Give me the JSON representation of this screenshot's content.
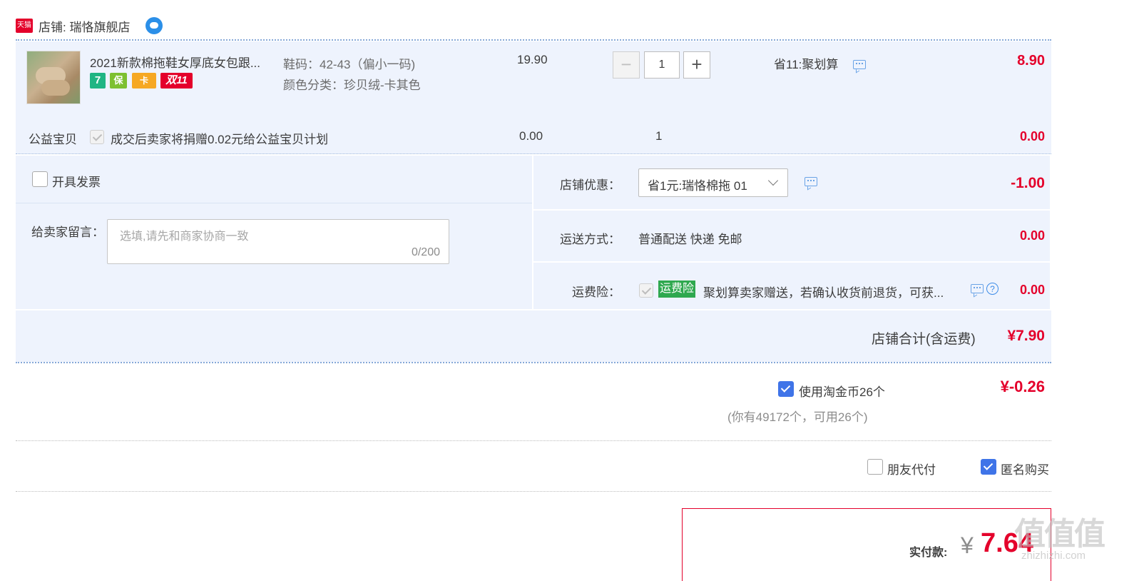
{
  "shop": {
    "tmall_badge": "天猫",
    "label": "店铺: 瑞恪旗舰店",
    "wangwang_icon": "wangwang-chat-icon"
  },
  "item": {
    "title": "2021新款棉拖鞋女厚底女包跟...",
    "badges": [
      "7",
      "保",
      "卡",
      "双11"
    ],
    "sku_size": "鞋码：42-43（偏小一码)",
    "sku_color": "颜色分类：珍贝绒-卡其色",
    "price": "19.90",
    "quantity": "1",
    "minus": "−",
    "plus": "+",
    "promo": "省11:聚划算",
    "subtotal": "8.90"
  },
  "charity": {
    "label": "公益宝贝",
    "text": "成交后卖家将捐赠0.02元给公益宝贝计划",
    "price": "0.00",
    "quantity": "1",
    "subtotal": "0.00"
  },
  "invoice": {
    "label": "开具发票"
  },
  "message": {
    "label": "给卖家留言：",
    "placeholder": "选填,请先和商家协商一致",
    "counter": "0/200"
  },
  "shop_discount": {
    "label": "店铺优惠：",
    "selected": "省1元:瑞恪棉拖 01",
    "amount": "-1.00"
  },
  "shipping": {
    "label": "运送方式：",
    "value": "普通配送 快递 免邮",
    "amount": "0.00"
  },
  "insurance": {
    "label": "运费险：",
    "tag": "运费险",
    "text": "聚划算卖家赠送，若确认收货前退货，可获...",
    "help": "?",
    "amount": "0.00"
  },
  "shop_total": {
    "label": "店铺合计(含运费)",
    "amount": "¥7.90"
  },
  "coins": {
    "label": "使用淘金币26个",
    "amount": "¥-0.26",
    "note": "(你有49172个，可用26个)",
    "checked": true
  },
  "options": {
    "friend_pay": "朋友代付",
    "anonymous": "匿名购买",
    "anonymous_checked": true
  },
  "payment": {
    "label": "实付款:",
    "currency": "¥",
    "amount": "7.64"
  },
  "watermark": "值|值|值 zhizhizhi.com",
  "colors": {
    "accent_red": "#e4002b",
    "checkbox_blue": "#3f74e8",
    "row_bg": "#eef3fd",
    "insurance_green": "#2fa84f"
  }
}
